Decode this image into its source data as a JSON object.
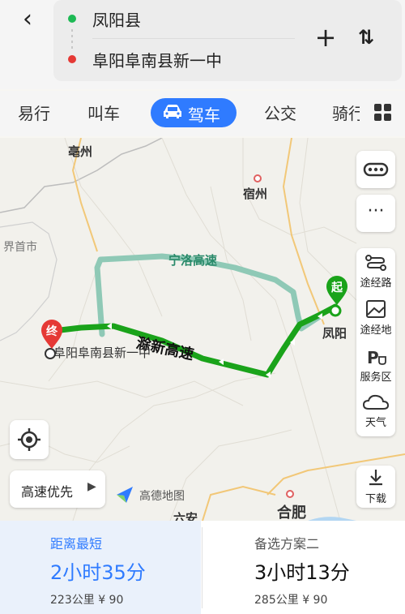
{
  "header": {
    "back_icon": "back-arrow-icon",
    "start": "凤阳县",
    "end": "阜阳阜南县新一中"
  },
  "tabs": [
    {
      "label": "易行"
    },
    {
      "label": "叫车"
    },
    {
      "label": "驾车"
    },
    {
      "label": "公交"
    },
    {
      "label": "骑行"
    }
  ],
  "map": {
    "cities": {
      "bozhou": "亳州",
      "suzhou": "宿州",
      "jieshou": "界首市",
      "hefei": "合肥",
      "luan": "六安",
      "fengyang": "凤阳"
    },
    "roads": {
      "ningluo": "宁洛高速",
      "chuxin": "滁新高速"
    },
    "destination_label": "阜阳阜南县新一中",
    "start_marker": "起",
    "end_marker": "终",
    "watermark": "高德地图",
    "highway_pref": "高速优先",
    "colors": {
      "primary_route": "#1aa31a",
      "alt_route": "#8fc9b6",
      "accent": "#2f7bff"
    }
  },
  "controls": {
    "waypoint_route": "途经路",
    "waypoint_place": "途经地",
    "service_area": "服务区",
    "weather": "天气",
    "download": "下载"
  },
  "plans": [
    {
      "title": "距离最短",
      "time": "2小时35分",
      "distance": "223公里",
      "cost": "¥ 90"
    },
    {
      "title": "备选方案二",
      "time": "3小时13分",
      "distance": "285公里",
      "cost": "¥ 90"
    }
  ]
}
